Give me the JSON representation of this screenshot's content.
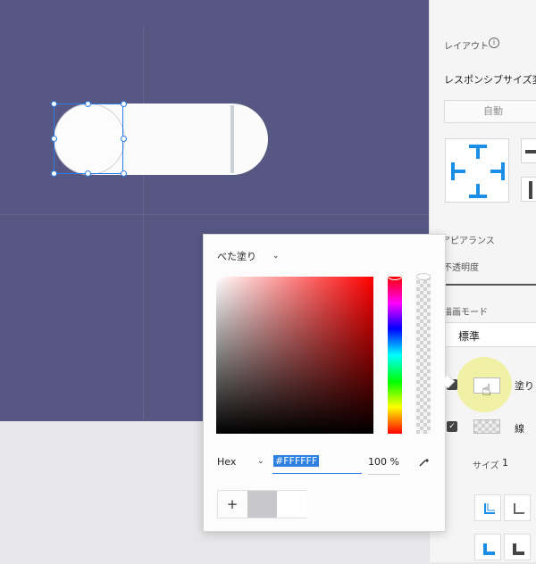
{
  "canvas": {
    "background": "#575784"
  },
  "panel": {
    "layout_label": "レイアウト",
    "info_icon": "info-icon",
    "responsive_label": "レスポンシブサイズ変更",
    "auto_button": "自動",
    "appearance_label": "アピアランス",
    "opacity_label": "不透明度",
    "blend_mode_label": "描画モード",
    "blend_mode_value": "標準",
    "fill_label": "塗り",
    "stroke_label": "線",
    "size_label": "サイズ",
    "size_value": "1"
  },
  "color_picker": {
    "fill_type": "べた塗り",
    "hex_label": "Hex",
    "hex_value": "#FFFFFF",
    "opacity_value": "100 %",
    "add_swatch": "+",
    "hue": "#ff0000",
    "swatches": [
      "#c8c8cc",
      "#ffffff"
    ]
  }
}
